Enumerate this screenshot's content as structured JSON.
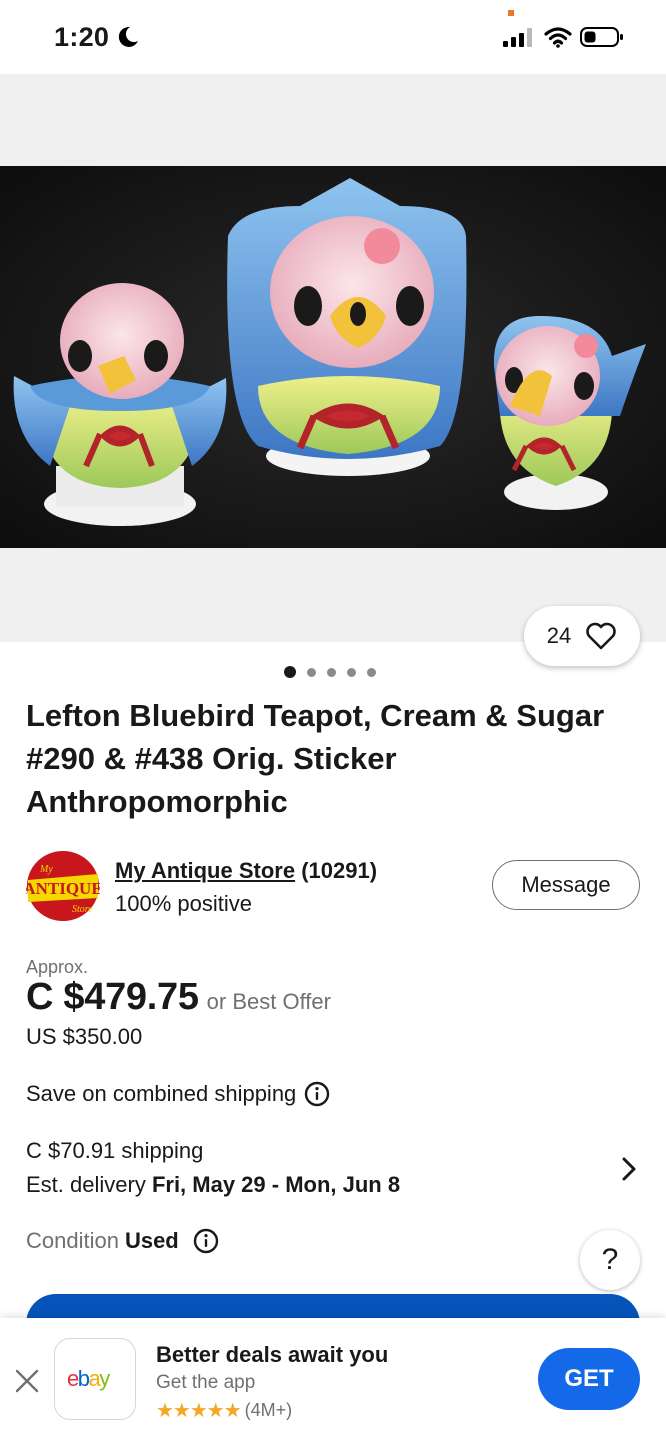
{
  "status_bar": {
    "time": "1:20",
    "icons": [
      "moon-icon",
      "signal-icon",
      "wifi-icon",
      "battery-icon"
    ]
  },
  "gallery": {
    "image_alt": "Lefton bluebird teapot, sugar bowl and creamer set",
    "watch_count": "24",
    "page_indicator": {
      "total": 5,
      "active": 1
    }
  },
  "listing": {
    "title": "Lefton Bluebird Teapot, Cream & Sugar #290 & #438 Orig. Sticker Anthropomorphic"
  },
  "seller": {
    "name": "My Antique Store",
    "score": "(10291)",
    "feedback": "100% positive",
    "message_label": "Message",
    "logo_text": "ANTIQUE",
    "logo_text_small_top": "My",
    "logo_text_small_bottom": "Store"
  },
  "price": {
    "approx_label": "Approx.",
    "amount": "C $479.75",
    "offer_label": "or Best Offer",
    "original": "US $350.00"
  },
  "shipping": {
    "combined": "Save on combined shipping",
    "cost": "C $70.91 shipping",
    "delivery_label": "Est. delivery ",
    "delivery_dates": "Fri, May 29 - Mon, Jun 8"
  },
  "condition": {
    "label": "Condition",
    "value": "Used"
  },
  "help": {
    "label": "?"
  },
  "app_banner": {
    "title": "Better deals await you",
    "subtitle": "Get the app",
    "stars": "★★★★★",
    "rating_count": "(4M+)",
    "get_label": "GET",
    "app_logo": "ebay"
  },
  "colors": {
    "cta_blue": "#0654ba",
    "get_blue": "#1469e8",
    "star_gold": "#f5a623",
    "ebay_red": "#e53238",
    "ebay_blue": "#0064d2",
    "ebay_yellow": "#f5af02",
    "ebay_green": "#86b817"
  }
}
